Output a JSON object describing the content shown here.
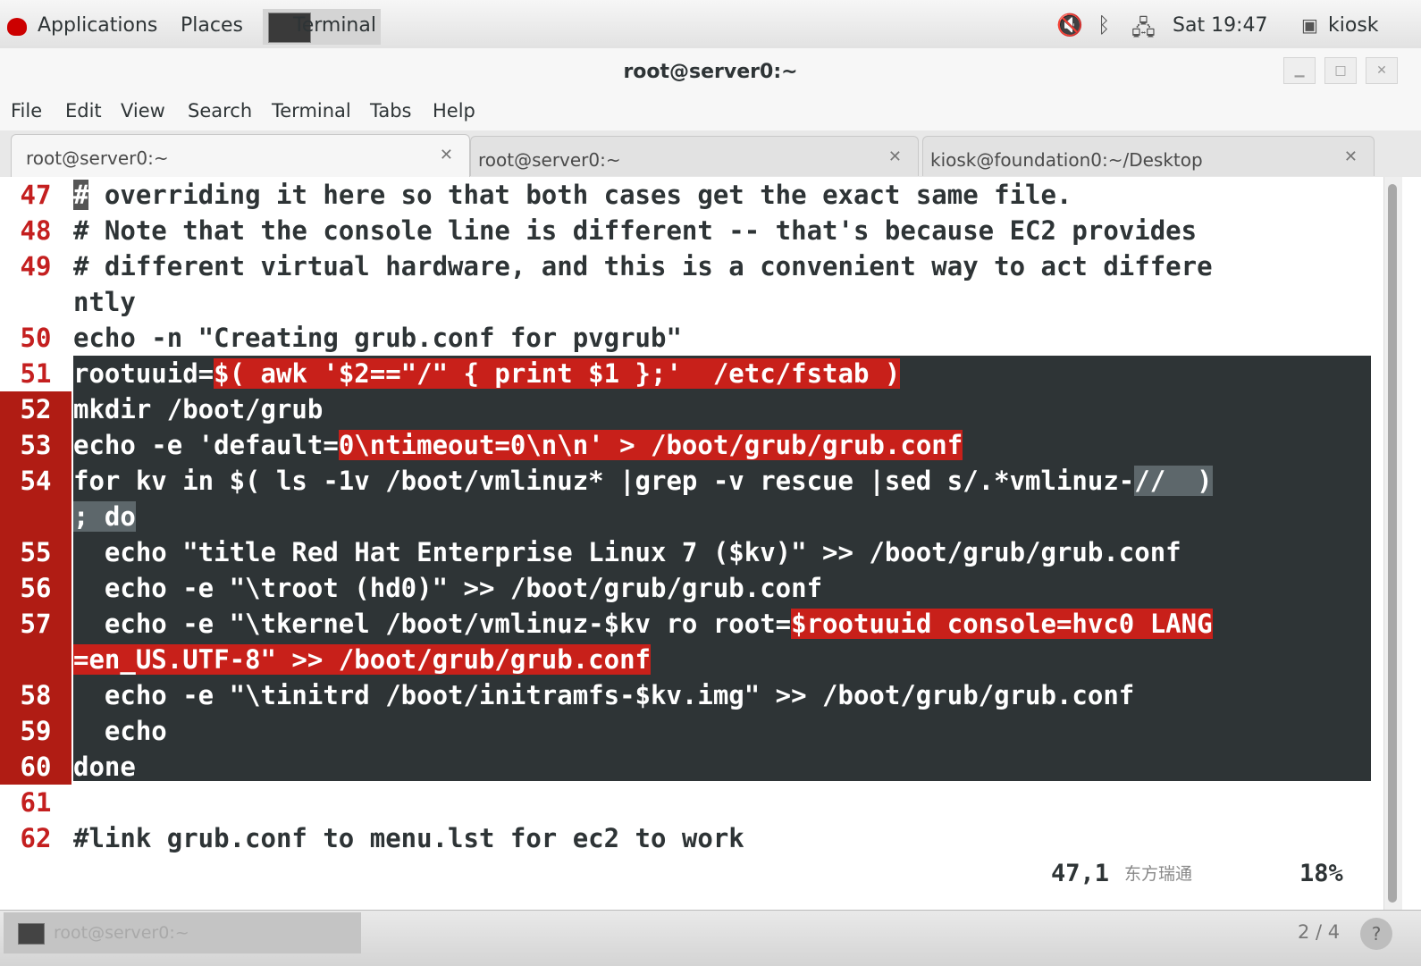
{
  "panel": {
    "applications": "Applications",
    "places": "Places",
    "task": "Terminal",
    "clock": "Sat 19:47",
    "user": "kiosk"
  },
  "window": {
    "title": "root@server0:~"
  },
  "menu": [
    "File",
    "Edit",
    "View",
    "Search",
    "Terminal",
    "Tabs",
    "Help"
  ],
  "tabs": [
    {
      "label": "root@server0:~",
      "active": true
    },
    {
      "label": "root@server0:~",
      "active": false
    },
    {
      "label": "kiosk@foundation0:~/Desktop",
      "active": false
    }
  ],
  "lines": [
    {
      "num": "47",
      "segs": [
        {
          "t": "#",
          "c": "cursor"
        },
        {
          "t": " overriding it here so that both cases get the exact same file."
        }
      ]
    },
    {
      "num": "48",
      "segs": [
        {
          "t": "# Note that the console line is different -- that's because EC2 provides"
        }
      ]
    },
    {
      "num": "49",
      "segs": [
        {
          "t": "# different virtual hardware, and this is a convenient way to act differe"
        }
      ]
    },
    {
      "num": "",
      "segs": [
        {
          "t": "ntly"
        }
      ]
    },
    {
      "num": "50",
      "segs": [
        {
          "t": "echo -n \"Creating grub.conf for pvgrub\""
        }
      ]
    },
    {
      "num": "51",
      "segs": [
        {
          "t": "rootuuid="
        },
        {
          "t": "$( awk '$2==\"/\" { print $1 };'  /etc/fstab )",
          "c": "r"
        }
      ]
    },
    {
      "num": "52",
      "segs": [
        {
          "t": "mkdir /boot/grub"
        }
      ]
    },
    {
      "num": "53",
      "segs": [
        {
          "t": "echo -e 'default="
        },
        {
          "t": "0\\ntimeout=0\\n\\n' > /boot/grub/grub.conf",
          "c": "r"
        }
      ]
    },
    {
      "num": "54",
      "segs": [
        {
          "t": "for kv in $( ls -1v /boot/vmlinuz* |grep -v rescue |sed s/.*vmlinuz-"
        },
        {
          "t": "//  )",
          "c": "g"
        }
      ]
    },
    {
      "num": "",
      "segs": [
        {
          "t": "; do",
          "c": "g"
        }
      ]
    },
    {
      "num": "55",
      "segs": [
        {
          "t": "  echo \"title Red Hat Enterprise Linux 7 ($kv)\" >> /boot/grub/grub.conf"
        }
      ]
    },
    {
      "num": "56",
      "segs": [
        {
          "t": "  echo -e \"\\troot (hd0)\" >> /boot/grub/grub.conf"
        }
      ]
    },
    {
      "num": "57",
      "segs": [
        {
          "t": "  echo -e \"\\tkernel /boot/vmlinuz-$kv ro root="
        },
        {
          "t": "$rootuuid console=hvc0 LANG",
          "c": "r"
        }
      ]
    },
    {
      "num": "",
      "segs": [
        {
          "t": "=en_US.UTF-8\" >> /boot/grub/grub.conf",
          "c": "r"
        }
      ]
    },
    {
      "num": "58",
      "segs": [
        {
          "t": "  echo -e \"\\tinitrd /boot/initramfs-$kv.img\" >> /boot/grub/grub.conf"
        }
      ]
    },
    {
      "num": "59",
      "segs": [
        {
          "t": "  echo"
        }
      ]
    },
    {
      "num": "60",
      "segs": [
        {
          "t": "done"
        }
      ]
    },
    {
      "num": "61",
      "segs": []
    },
    {
      "num": "62",
      "segs": [
        {
          "t": "#link grub.conf to menu.lst for ec2 to work"
        }
      ]
    }
  ],
  "status": {
    "position": "47,1",
    "watermark": "东方瑞通",
    "percent": "18%"
  },
  "bottom": {
    "task": "root@server0:~",
    "workspace": "2 / 4"
  }
}
